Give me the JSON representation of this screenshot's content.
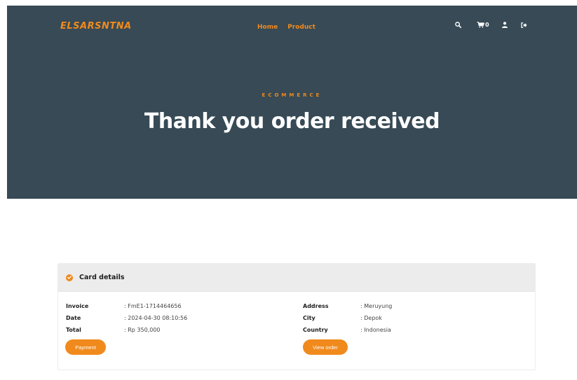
{
  "brand": {
    "logo_text": "ELSARSNTNA",
    "accent_color": "#f08a1c",
    "hero_bg": "#374a56"
  },
  "nav": {
    "items": [
      {
        "label": "Home"
      },
      {
        "label": "Product"
      }
    ]
  },
  "header_icons": {
    "search": "search-icon",
    "cart": "cart-icon",
    "cart_count": "0",
    "user": "user-icon",
    "logout": "logout-icon"
  },
  "hero": {
    "eyebrow": "ECOMMERCE",
    "title": "Thank you order received"
  },
  "card": {
    "title": "Card details",
    "left": [
      {
        "label": "Invoice",
        "value": ": FmE1-1714464656"
      },
      {
        "label": "Date",
        "value": ": 2024-04-30 08:10:56"
      },
      {
        "label": "Total",
        "value": ": Rp 350,000"
      }
    ],
    "right": [
      {
        "label": "Address",
        "value": ": Meruyung"
      },
      {
        "label": "City",
        "value": ": Depok"
      },
      {
        "label": "Country",
        "value": ": Indonesia"
      }
    ],
    "payment_button": "Payment",
    "view_order_button": "View order"
  }
}
